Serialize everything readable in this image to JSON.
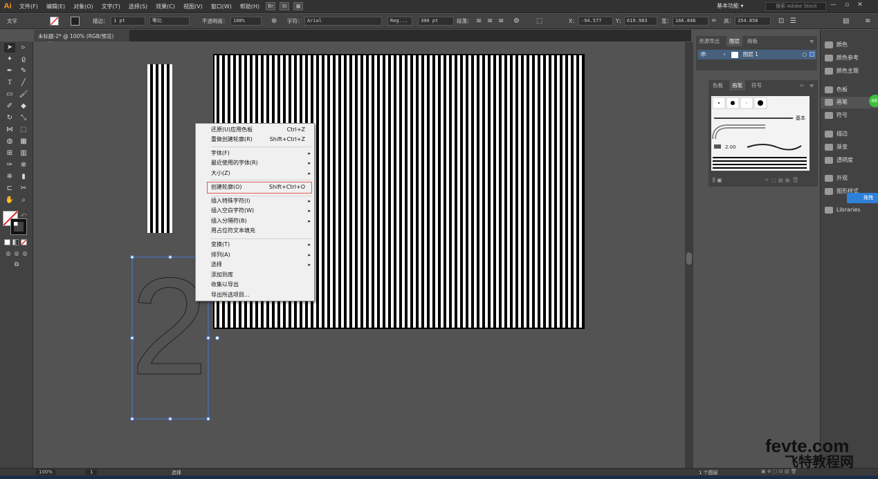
{
  "app": {
    "logo": "Ai",
    "menu": [
      "文件(F)",
      "编辑(E)",
      "对象(O)",
      "文字(T)",
      "选择(S)",
      "效果(C)",
      "视图(V)",
      "窗口(W)",
      "帮助(H)"
    ],
    "bridge_icon": "Br",
    "stock_icon": "St",
    "workspace": "基本功能 ▾",
    "stock_search_placeholder": "搜索 Adobe Stock",
    "window_controls": [
      "—",
      "▫",
      "✕"
    ]
  },
  "control_bar": {
    "mode": "文字",
    "stroke_label": "描边：",
    "stroke_weight": "1 pt",
    "stroke_profile": "等比",
    "opacity_label": "不透明度：",
    "opacity": "100%",
    "char_label": "字符：",
    "font": "Arial",
    "style": "Reg...",
    "size": "300 pt",
    "para_label": "段落：",
    "x_label": "X：",
    "x": "-94.577",
    "y_label": "Y：",
    "y": "619.983",
    "w_label": "宽：",
    "w": "166.846",
    "h_label": "高：",
    "h": "354.858"
  },
  "document": {
    "tab_title": "未标题-2* @ 100% (RGB/预览)",
    "tab_close": "×",
    "glyph": "2"
  },
  "context_menu": {
    "items": [
      {
        "label": "还原(U)应用色板",
        "shortcut": "Ctrl+Z",
        "arrow": ""
      },
      {
        "label": "重做创建轮廓(R)",
        "shortcut": "Shift+Ctrl+Z",
        "arrow": ""
      },
      {
        "label": "字体(F)",
        "shortcut": "",
        "arrow": "▸"
      },
      {
        "label": "最近使用的字体(R)",
        "shortcut": "",
        "arrow": "▸"
      },
      {
        "label": "大小(Z)",
        "shortcut": "",
        "arrow": "▸"
      },
      {
        "label": "创建轮廓(O)",
        "shortcut": "Shift+Ctrl+O",
        "arrow": ""
      },
      {
        "label": "插入特殊字符(I)",
        "shortcut": "",
        "arrow": "▸"
      },
      {
        "label": "插入空白字符(W)",
        "shortcut": "",
        "arrow": "▸"
      },
      {
        "label": "插入分隔符(B)",
        "shortcut": "",
        "arrow": "▸"
      },
      {
        "label": "用占位符文本填充",
        "shortcut": "",
        "arrow": ""
      },
      {
        "label": "变换(T)",
        "shortcut": "",
        "arrow": "▸"
      },
      {
        "label": "排列(A)",
        "shortcut": "",
        "arrow": "▸"
      },
      {
        "label": "选择",
        "shortcut": "",
        "arrow": "▸"
      },
      {
        "label": "添加到库",
        "shortcut": "",
        "arrow": ""
      },
      {
        "label": "收集以导出",
        "shortcut": "",
        "arrow": ""
      },
      {
        "label": "导出所选项目...",
        "shortcut": "",
        "arrow": ""
      }
    ]
  },
  "layers_panel": {
    "tabs": [
      "资源导出",
      "图层",
      "画板"
    ],
    "layer_name": "图层 1",
    "footer": "1 个图层"
  },
  "brush_panel": {
    "tabs": [
      "色板",
      "画笔",
      "符号"
    ],
    "basic_label": "基本",
    "size_label": "2.00"
  },
  "icon_panel": {
    "items": [
      "颜色",
      "颜色参考",
      "颜色主题",
      "色板",
      "画笔",
      "符号",
      "描边",
      "渐变",
      "透明度",
      "外观",
      "图形样式",
      "Libraries"
    ],
    "badge": "46",
    "tooltip": "拖拽"
  },
  "status": {
    "zoom": "100%",
    "artboard": "1",
    "tool": "选择"
  },
  "watermark": {
    "line1": "fevte.com",
    "line2": "飞特教程网"
  }
}
